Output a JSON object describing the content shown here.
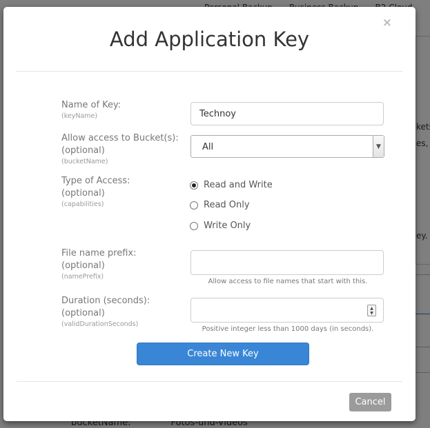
{
  "background": {
    "nav_items": [
      "Personal Backup",
      "Business Backup",
      "B2 Cloud"
    ],
    "fragments": [
      "kets",
      "es, c",
      "ey."
    ],
    "bottom_label": "bucketName:",
    "bottom_value": "Fotos-und-Videos"
  },
  "modal": {
    "title": "Add Application Key",
    "close_symbol": "×",
    "fields": {
      "key_name": {
        "label": "Name of Key:",
        "hint": "(keyName)",
        "value": "Technoy"
      },
      "bucket": {
        "label": "Allow access to Bucket(s):",
        "label_optional": "(optional)",
        "hint": "(bucketName)",
        "selected": "All"
      },
      "access_type": {
        "label": "Type of Access:",
        "label_optional": "(optional)",
        "hint": "(capabilities)",
        "options": [
          "Read and Write",
          "Read Only",
          "Write Only"
        ],
        "selected": "Read and Write"
      },
      "prefix": {
        "label": "File name prefix:",
        "label_optional": "(optional)",
        "hint": "(namePrefix)",
        "value": "",
        "help": "Allow access to file names that start with this."
      },
      "duration": {
        "label": "Duration (seconds):",
        "label_optional": "(optional)",
        "hint": "(validDurationSeconds)",
        "value": "",
        "help": "Positive integer less than 1000 days (in seconds)."
      }
    },
    "create_button": "Create New Key",
    "cancel_button": "Cancel"
  }
}
